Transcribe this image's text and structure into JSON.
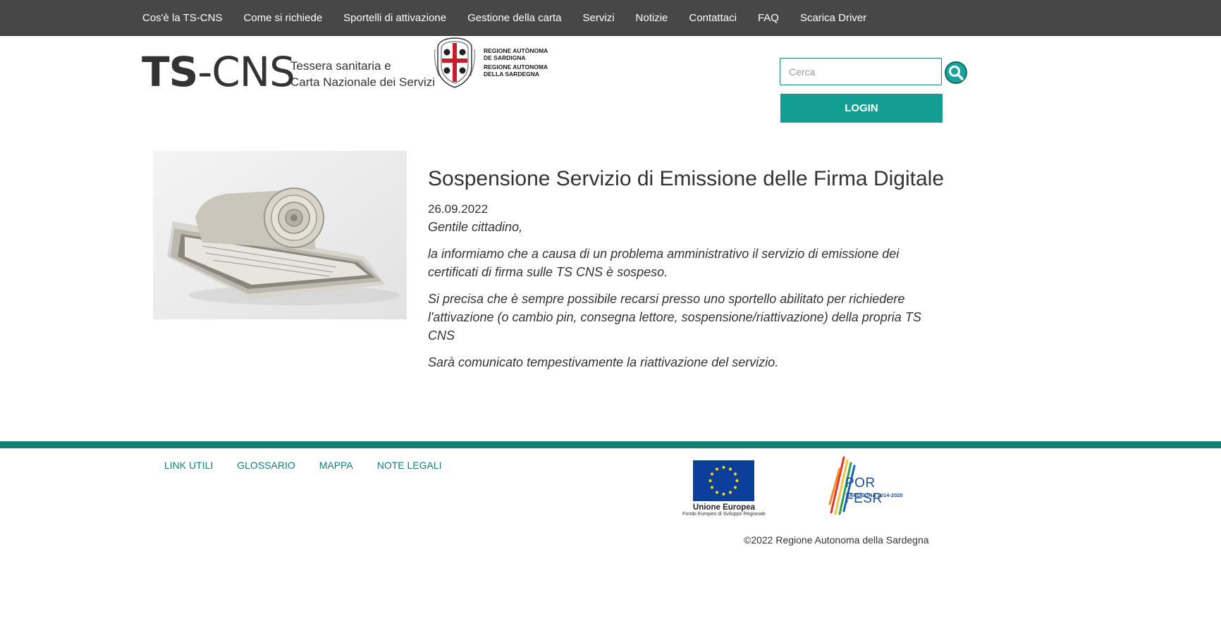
{
  "nav": {
    "items": [
      {
        "label": "Cos'è la TS-CNS"
      },
      {
        "label": "Come si richiede"
      },
      {
        "label": "Sportelli di attivazione"
      },
      {
        "label": "Gestione della carta"
      },
      {
        "label": "Servizi"
      },
      {
        "label": "Notizie"
      },
      {
        "label": "Contattaci"
      },
      {
        "label": "FAQ"
      },
      {
        "label": "Scarica Driver"
      }
    ]
  },
  "header": {
    "logo_bold": "TS",
    "logo_rest": "-CNS",
    "subtitle_line1": "Tessera sanitaria e",
    "subtitle_line2": "Carta Nazionale dei Servizi",
    "region_line1": "Regione Autònoma",
    "region_line2": "de Sardigna",
    "region_line3": "Regione Autonoma",
    "region_line4": "della Sardegna",
    "search_placeholder": "Cerca",
    "login_label": "LOGIN"
  },
  "article": {
    "title": "Sospensione Servizio di Emissione delle Firma Digitale",
    "date": "26.09.2022",
    "greeting": "Gentile cittadino,",
    "paragraphs": [
      "la informiamo che a causa di un problema amministrativo il servizio di emissione dei certificati di firma sulle TS CNS è sospeso.",
      "Si precisa che è sempre possibile recarsi presso uno sportello abilitato per richiedere l'attivazione (o cambio pin, consegna lettore, sospensione/riattivazione) della propria TS CNS",
      "Sarà comunicato tempestivamente la riattivazione del servizio."
    ]
  },
  "footer": {
    "links": [
      {
        "label": "LINK UTILI"
      },
      {
        "label": "GLOSSARIO"
      },
      {
        "label": "MAPPA"
      },
      {
        "label": "NOTE LEGALI"
      }
    ],
    "eu_caption": "Unione Europea",
    "eu_subcaption": "Fondo Europeo di Sviluppo Regionale",
    "por_title": "POR FESR",
    "por_subtitle": "SARDEGNA 2014-2020",
    "copyright": "©2022 Regione Autonoma della Sardegna"
  },
  "colors": {
    "nav_bg": "#474747",
    "accent": "#139e94",
    "footer_accent": "#157d76"
  }
}
